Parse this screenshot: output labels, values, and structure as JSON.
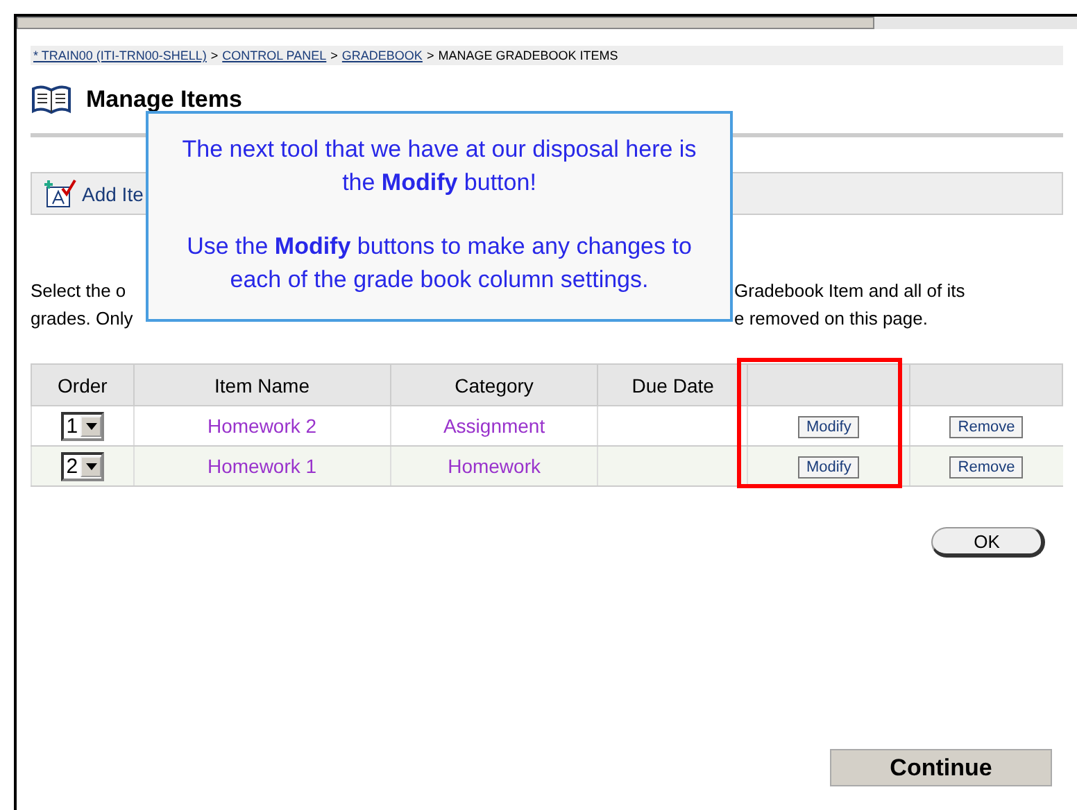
{
  "breadcrumb": [
    {
      "label": "* TRAIN00 (ITI-TRN00-SHELL)",
      "link": true
    },
    {
      "label": "CONTROL PANEL",
      "link": true
    },
    {
      "label": "GRADEBOOK",
      "link": true
    },
    {
      "label": "MANAGE GRADEBOOK ITEMS",
      "link": false
    }
  ],
  "separator": ">",
  "heading": "Manage Items",
  "action_bar": {
    "label": "Add Ite"
  },
  "instructions": {
    "line_1_left": "Select the o",
    "line_1_right": "Gradebook Item and all of its",
    "line_2_left": "grades. Only",
    "line_2_right": "e removed on this page."
  },
  "table": {
    "columns": [
      {
        "label": "Order",
        "highlighted": false
      },
      {
        "label": "Item Name",
        "highlighted": false
      },
      {
        "label": "Category",
        "highlighted": false
      },
      {
        "label": "Due Date",
        "highlighted": false
      },
      {
        "highlighted": true
      },
      {
        "highlighted": false
      }
    ],
    "rows": [
      {
        "order": "1",
        "name": "Homework 2",
        "category": "Assignment",
        "modify": "Modify",
        "remove": "Remove"
      },
      {
        "order": "2",
        "name": "Homework 1",
        "category": "Homework",
        "modify": "Modify",
        "remove": "Remove"
      }
    ]
  },
  "ok_button": "OK",
  "continue_button": "Continue",
  "callout": {
    "paragraphs": [
      "The next tool that we have at our disposal here is the **Modify** button!",
      "Use the **Modify** buttons to make any changes to each of the grade book column settings."
    ]
  }
}
